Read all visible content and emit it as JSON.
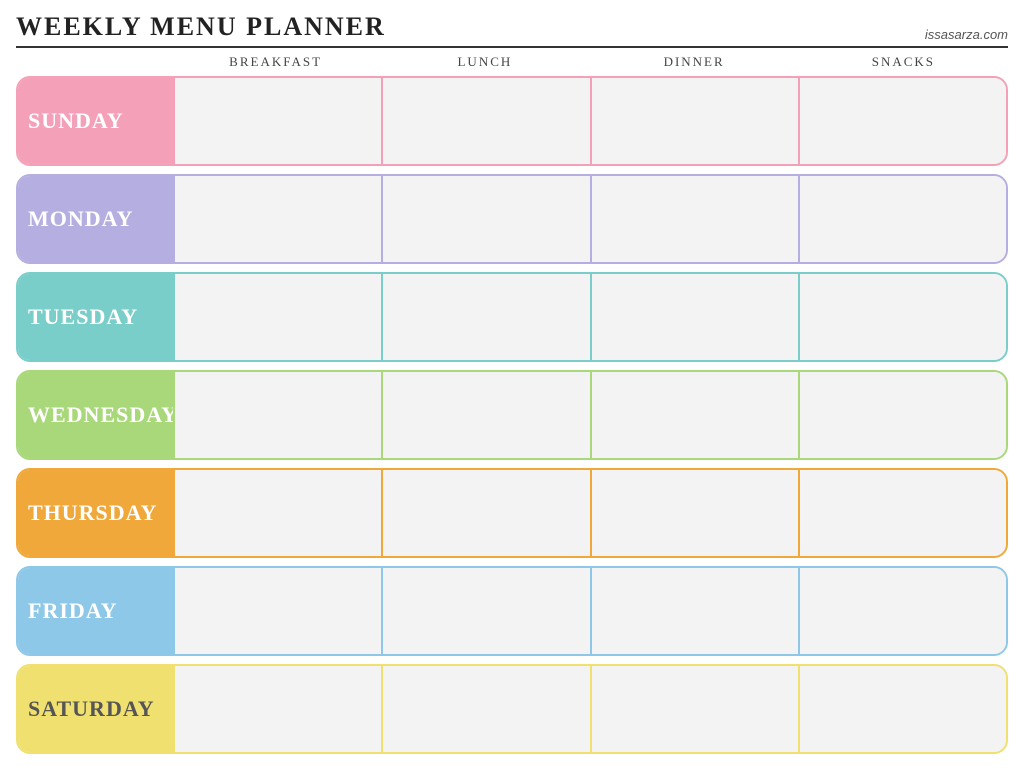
{
  "header": {
    "title": "Weekly Menu Planner",
    "website": "issasarza.com"
  },
  "columns": {
    "day_placeholder": "",
    "breakfast": "Breakfast",
    "lunch": "Lunch",
    "dinner": "Dinner",
    "snacks": "Snacks"
  },
  "days": [
    {
      "id": "sunday",
      "label": "Sunday",
      "class": "row-sunday"
    },
    {
      "id": "monday",
      "label": "Monday",
      "class": "row-monday"
    },
    {
      "id": "tuesday",
      "label": "Tuesday",
      "class": "row-tuesday"
    },
    {
      "id": "wednesday",
      "label": "Wednesday",
      "class": "row-wednesday"
    },
    {
      "id": "thursday",
      "label": "Thursday",
      "class": "row-thursday"
    },
    {
      "id": "friday",
      "label": "Friday",
      "class": "row-friday"
    },
    {
      "id": "saturday",
      "label": "Saturday",
      "class": "row-saturday"
    }
  ]
}
